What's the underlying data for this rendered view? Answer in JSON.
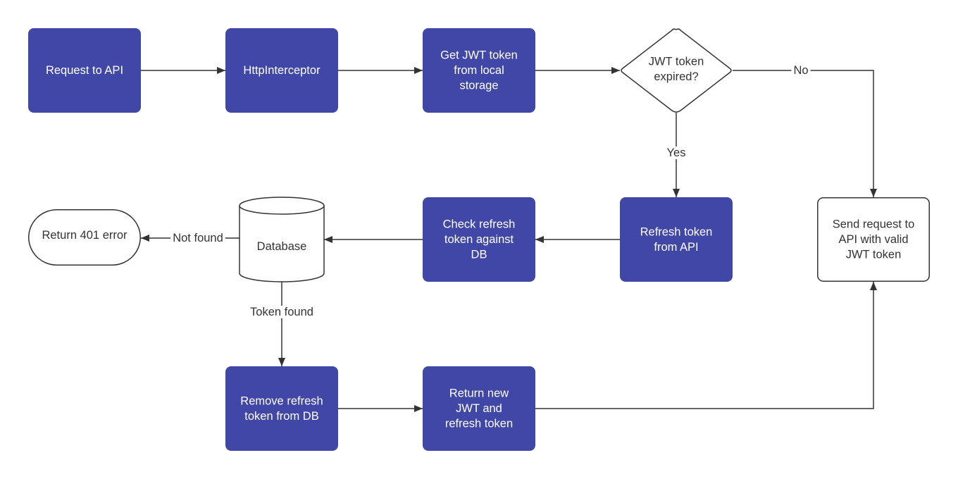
{
  "colors": {
    "process_fill": "#4047a6",
    "process_text": "#ffffff",
    "outline_fill": "#ffffff",
    "outline_stroke": "#333333",
    "outline_text": "#333333",
    "connector": "#333333",
    "background": "#ffffff"
  },
  "nodes": [
    {
      "id": "request-to-api",
      "shape": "process",
      "lines": [
        "Request to API"
      ]
    },
    {
      "id": "http-interceptor",
      "shape": "process",
      "lines": [
        "HttpInterceptor"
      ]
    },
    {
      "id": "get-jwt-token",
      "shape": "process",
      "lines": [
        "Get JWT token",
        "from local",
        "storage"
      ]
    },
    {
      "id": "jwt-expired-decision",
      "shape": "decision",
      "lines": [
        "JWT token",
        "expired?"
      ]
    },
    {
      "id": "send-request",
      "shape": "outlined-process",
      "lines": [
        "Send request to",
        "API with valid",
        "JWT token"
      ]
    },
    {
      "id": "refresh-token-from-api",
      "shape": "process",
      "lines": [
        "Refresh token",
        "from API"
      ]
    },
    {
      "id": "check-refresh-token",
      "shape": "process",
      "lines": [
        "Check refresh",
        "token against",
        "DB"
      ]
    },
    {
      "id": "database",
      "shape": "database",
      "lines": [
        "Database"
      ]
    },
    {
      "id": "return-401",
      "shape": "terminator",
      "lines": [
        "Return 401 error"
      ]
    },
    {
      "id": "remove-refresh-token",
      "shape": "process",
      "lines": [
        "Remove refresh",
        "token from DB"
      ]
    },
    {
      "id": "return-new-tokens",
      "shape": "process",
      "lines": [
        "Return new",
        "JWT and",
        "refresh token"
      ]
    }
  ],
  "edges": [
    {
      "id": "request-to-interceptor",
      "from": "request-to-api",
      "to": "http-interceptor",
      "label": ""
    },
    {
      "id": "interceptor-to-get-token",
      "from": "http-interceptor",
      "to": "get-jwt-token",
      "label": ""
    },
    {
      "id": "get-token-to-decision",
      "from": "get-jwt-token",
      "to": "jwt-expired-decision",
      "label": ""
    },
    {
      "id": "decision-no",
      "from": "jwt-expired-decision",
      "to": "send-request",
      "label": "No"
    },
    {
      "id": "decision-yes",
      "from": "jwt-expired-decision",
      "to": "refresh-token-from-api",
      "label": "Yes"
    },
    {
      "id": "refresh-to-check",
      "from": "refresh-token-from-api",
      "to": "check-refresh-token",
      "label": ""
    },
    {
      "id": "check-to-database",
      "from": "check-refresh-token",
      "to": "database",
      "label": ""
    },
    {
      "id": "database-not-found",
      "from": "database",
      "to": "return-401",
      "label": "Not found"
    },
    {
      "id": "database-token-found",
      "from": "database",
      "to": "remove-refresh-token",
      "label": "Token found"
    },
    {
      "id": "remove-to-return",
      "from": "remove-refresh-token",
      "to": "return-new-tokens",
      "label": ""
    },
    {
      "id": "return-to-send",
      "from": "return-new-tokens",
      "to": "send-request",
      "label": ""
    }
  ]
}
